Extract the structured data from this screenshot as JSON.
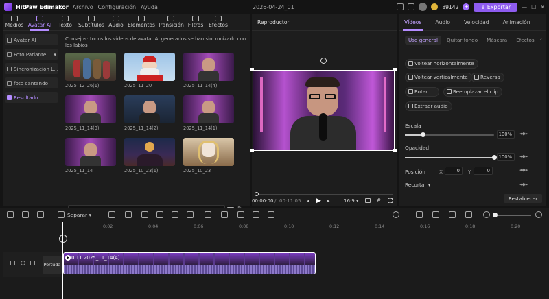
{
  "app": {
    "name": "HitPaw Edimakor",
    "menus": [
      "Archivo",
      "Configuración",
      "Ayuda"
    ],
    "file_name": "2026-04-24_01",
    "credits": "89142",
    "export_label": "Exportar"
  },
  "top_nav": [
    {
      "label": "Medios",
      "icon": "media-icon"
    },
    {
      "label": "Avatar AI",
      "icon": "avatar-icon",
      "active": true
    },
    {
      "label": "Texto",
      "icon": "text-icon"
    },
    {
      "label": "Subtítulos",
      "icon": "subtitles-icon"
    },
    {
      "label": "Audio",
      "icon": "audio-icon"
    },
    {
      "label": "Elementos",
      "icon": "elements-icon"
    },
    {
      "label": "Transición",
      "icon": "transition-icon"
    },
    {
      "label": "Filtros",
      "icon": "filters-icon"
    },
    {
      "label": "Efectos",
      "icon": "effects-icon"
    }
  ],
  "sidebar": [
    {
      "label": "Avatar AI"
    },
    {
      "label": "Foto Parlante"
    },
    {
      "label": "Sincronización L..."
    },
    {
      "label": "foto cantando"
    },
    {
      "label": "Resultado",
      "active": true
    }
  ],
  "notice": "Consejos: todos los videos de avatar AI generados se han sincronizado con los labios",
  "thumbnails": [
    {
      "label": "2025_12_26(1)"
    },
    {
      "label": "2025_11_20"
    },
    {
      "label": "2025_11_14(4)"
    },
    {
      "label": "2025_11_14(3)"
    },
    {
      "label": "2025_11_14(2)"
    },
    {
      "label": "2025_11_14(1)"
    },
    {
      "label": "2025_11_14"
    },
    {
      "label": "2025_10_23(1)"
    },
    {
      "label": "2025_10_23"
    }
  ],
  "path": "D:/HitPaw Software/HitPaw Edimakor/AI Generator",
  "player": {
    "title": "Reproductor",
    "current": "00:00:00",
    "total": "00:11:05",
    "ratio": "16:9"
  },
  "right_panel": {
    "tabs": [
      "Vídeos",
      "Audio",
      "Velocidad",
      "Animación"
    ],
    "subtabs": [
      "Uso general",
      "Quitar fondo",
      "Máscara",
      "Efectos"
    ],
    "actions": [
      "Voltear horizontalmente",
      "Voltear verticalmente",
      "Reversa",
      "Rotar",
      "Reemplazar el clip",
      "Extraer audio"
    ],
    "scale_label": "Escala",
    "scale_value": "100%",
    "scale_fraction": 0.2,
    "opacity_label": "Opacidad",
    "opacity_value": "100%",
    "opacity_fraction": 1.0,
    "position_label": "Posición",
    "x_label": "X",
    "x_value": "0",
    "y_label": "Y",
    "y_value": "0",
    "crop_label": "Recortar",
    "reset_label": "Restablecer"
  },
  "timeline": {
    "split_label": "Separar",
    "ticks": [
      "0:02",
      "0:04",
      "0:06",
      "0:08",
      "0:10",
      "0:12",
      "0:14",
      "0:16",
      "0:18",
      "0:20"
    ],
    "track_label": "Portuda",
    "clip_label": "0:11  2025_11_14(4)"
  }
}
